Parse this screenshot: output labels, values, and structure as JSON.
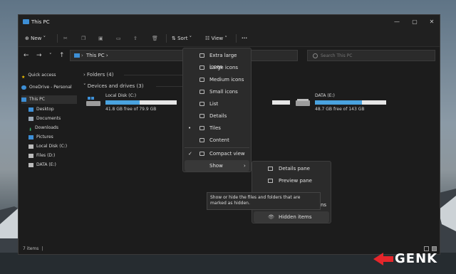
{
  "window": {
    "title": "This PC"
  },
  "toolbar": {
    "new_label": "New",
    "sort_label": "Sort",
    "view_label": "View",
    "more_label": "···"
  },
  "address": {
    "path": "This PC",
    "search_placeholder": "Search This PC"
  },
  "sidebar": {
    "items": [
      {
        "label": "Quick access",
        "icon": "star-icon",
        "color": "#f5c400"
      },
      {
        "label": "OneDrive - Personal",
        "icon": "cloud-icon",
        "color": "#3d8fd6"
      },
      {
        "label": "This PC",
        "icon": "computer-icon",
        "color": "#3d8fd6"
      },
      {
        "label": "Desktop",
        "icon": "desktop-icon",
        "color": "#3d8fd6"
      },
      {
        "label": "Documents",
        "icon": "documents-icon",
        "color": "#9aa7b4"
      },
      {
        "label": "Downloads",
        "icon": "download-icon",
        "color": "#38b26a"
      },
      {
        "label": "Pictures",
        "icon": "pictures-icon",
        "color": "#3d8fd6"
      },
      {
        "label": "Local Disk (C:)",
        "icon": "drive-icon",
        "color": "#bbbbbb"
      },
      {
        "label": "Files (D:)",
        "icon": "drive-icon",
        "color": "#bbbbbb"
      },
      {
        "label": "DATA (E:)",
        "icon": "drive-icon",
        "color": "#bbbbbb"
      }
    ]
  },
  "content": {
    "folders_header": "Folders (4)",
    "drives_header": "Devices and drives (3)",
    "drives": [
      {
        "name": "Local Disk (C:)",
        "free": "41.8 GB free of 79.9 GB",
        "used_fraction": 0.48
      },
      {
        "name": "DATA (E:)",
        "free": "48.7 GB free of 143 GB",
        "used_fraction": 0.66
      }
    ]
  },
  "view_menu": {
    "items": [
      {
        "label": "Extra large icons",
        "checked": false
      },
      {
        "label": "Large icons",
        "checked": false
      },
      {
        "label": "Medium icons",
        "checked": false
      },
      {
        "label": "Small icons",
        "checked": false
      },
      {
        "label": "List",
        "checked": false
      },
      {
        "label": "Details",
        "checked": false
      },
      {
        "label": "Tiles",
        "checked": true,
        "mark": "•"
      },
      {
        "label": "Content",
        "checked": false
      },
      {
        "label": "Compact view",
        "checked": true,
        "mark": "✓"
      },
      {
        "label": "Show",
        "checked": false
      }
    ]
  },
  "show_submenu": {
    "items": [
      {
        "label": "Details pane"
      },
      {
        "label": "Preview pane"
      },
      {
        "label": "ns"
      },
      {
        "label": "Hidden items"
      }
    ]
  },
  "tooltip": {
    "text": "Show or hide the files and folders that are marked as hidden."
  },
  "status": {
    "text": "7 items"
  },
  "watermark": {
    "text": "GENK"
  },
  "colors": {
    "accent": "#4aa3df",
    "window_bg": "#1c1c1c",
    "menu_bg": "#2b2b2b"
  }
}
